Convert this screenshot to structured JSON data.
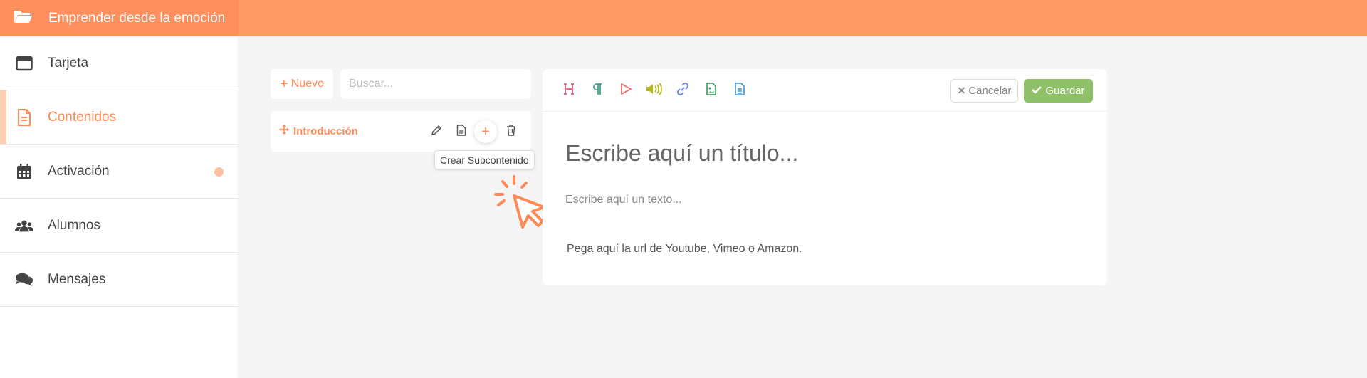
{
  "app": {
    "title": "Emprender desde la emoción",
    "accent": "#ff8a55",
    "header_color": "#ff9966"
  },
  "sidebar": {
    "items": [
      {
        "label": "Tarjeta",
        "icon": "window-icon"
      },
      {
        "label": "Contenidos",
        "icon": "document-icon",
        "active": true
      },
      {
        "label": "Activación",
        "icon": "calendar-icon",
        "has_dot": true
      },
      {
        "label": "Alumnos",
        "icon": "users-icon"
      },
      {
        "label": "Mensajes",
        "icon": "chat-icon"
      }
    ]
  },
  "contents": {
    "new_label": "Nuevo",
    "search_placeholder": "Buscar...",
    "tree": [
      {
        "label": "Introducción"
      }
    ],
    "tooltip": "Crear Subcontenido"
  },
  "editor": {
    "tools": [
      "heading-icon",
      "paragraph-icon",
      "play-icon",
      "audio-icon",
      "link-icon",
      "image-file-icon",
      "document-icon"
    ],
    "cancel_label": "Cancelar",
    "save_label": "Guardar",
    "save_color": "#8fc16a",
    "title_placeholder": "Escribe aquí un título...",
    "text_placeholder": "Escribe aquí un texto...",
    "url_placeholder": "Pega aquí la url de Youtube, Vimeo o Amazon."
  }
}
